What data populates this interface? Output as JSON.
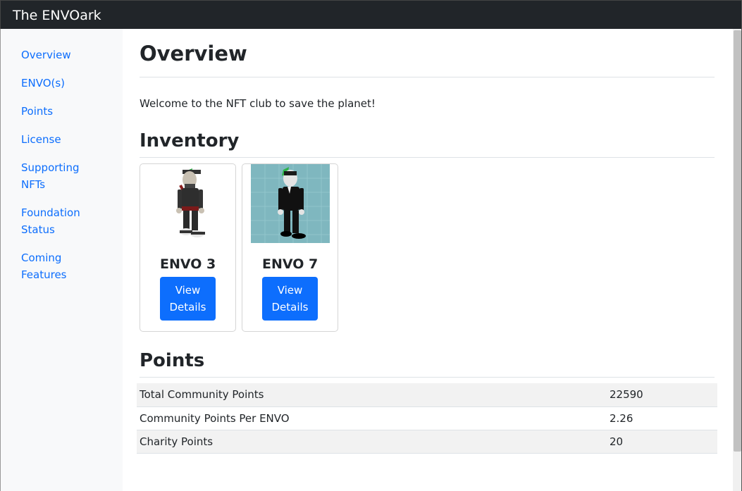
{
  "app": {
    "brand": "The ENVOark"
  },
  "sidebar": {
    "items": [
      {
        "label": "Overview"
      },
      {
        "label": "ENVO(s)"
      },
      {
        "label": "Points"
      },
      {
        "label": "License"
      },
      {
        "label_line1": "Supporting",
        "label_line2": "NFTs"
      },
      {
        "label_line1": "Foundation",
        "label_line2": "Status"
      },
      {
        "label_line1": "Coming",
        "label_line2": "Features"
      }
    ]
  },
  "main": {
    "title": "Overview",
    "welcome": "Welcome to the NFT club to save the planet!",
    "inventory_heading": "Inventory",
    "cards": [
      {
        "title": "ENVO 3",
        "button_line1": "View",
        "button_line2": "Details"
      },
      {
        "title": "ENVO 7",
        "button_line1": "View",
        "button_line2": "Details"
      }
    ],
    "points_heading": "Points",
    "points": [
      {
        "label": "Total Community Points",
        "value": "22590"
      },
      {
        "label": "Community Points Per ENVO",
        "value": "2.26"
      },
      {
        "label": "Charity Points",
        "value": "20"
      }
    ]
  },
  "colors": {
    "accent": "#0d6efd",
    "navbar": "#212529",
    "sidebar_bg": "#f8f9fa"
  }
}
